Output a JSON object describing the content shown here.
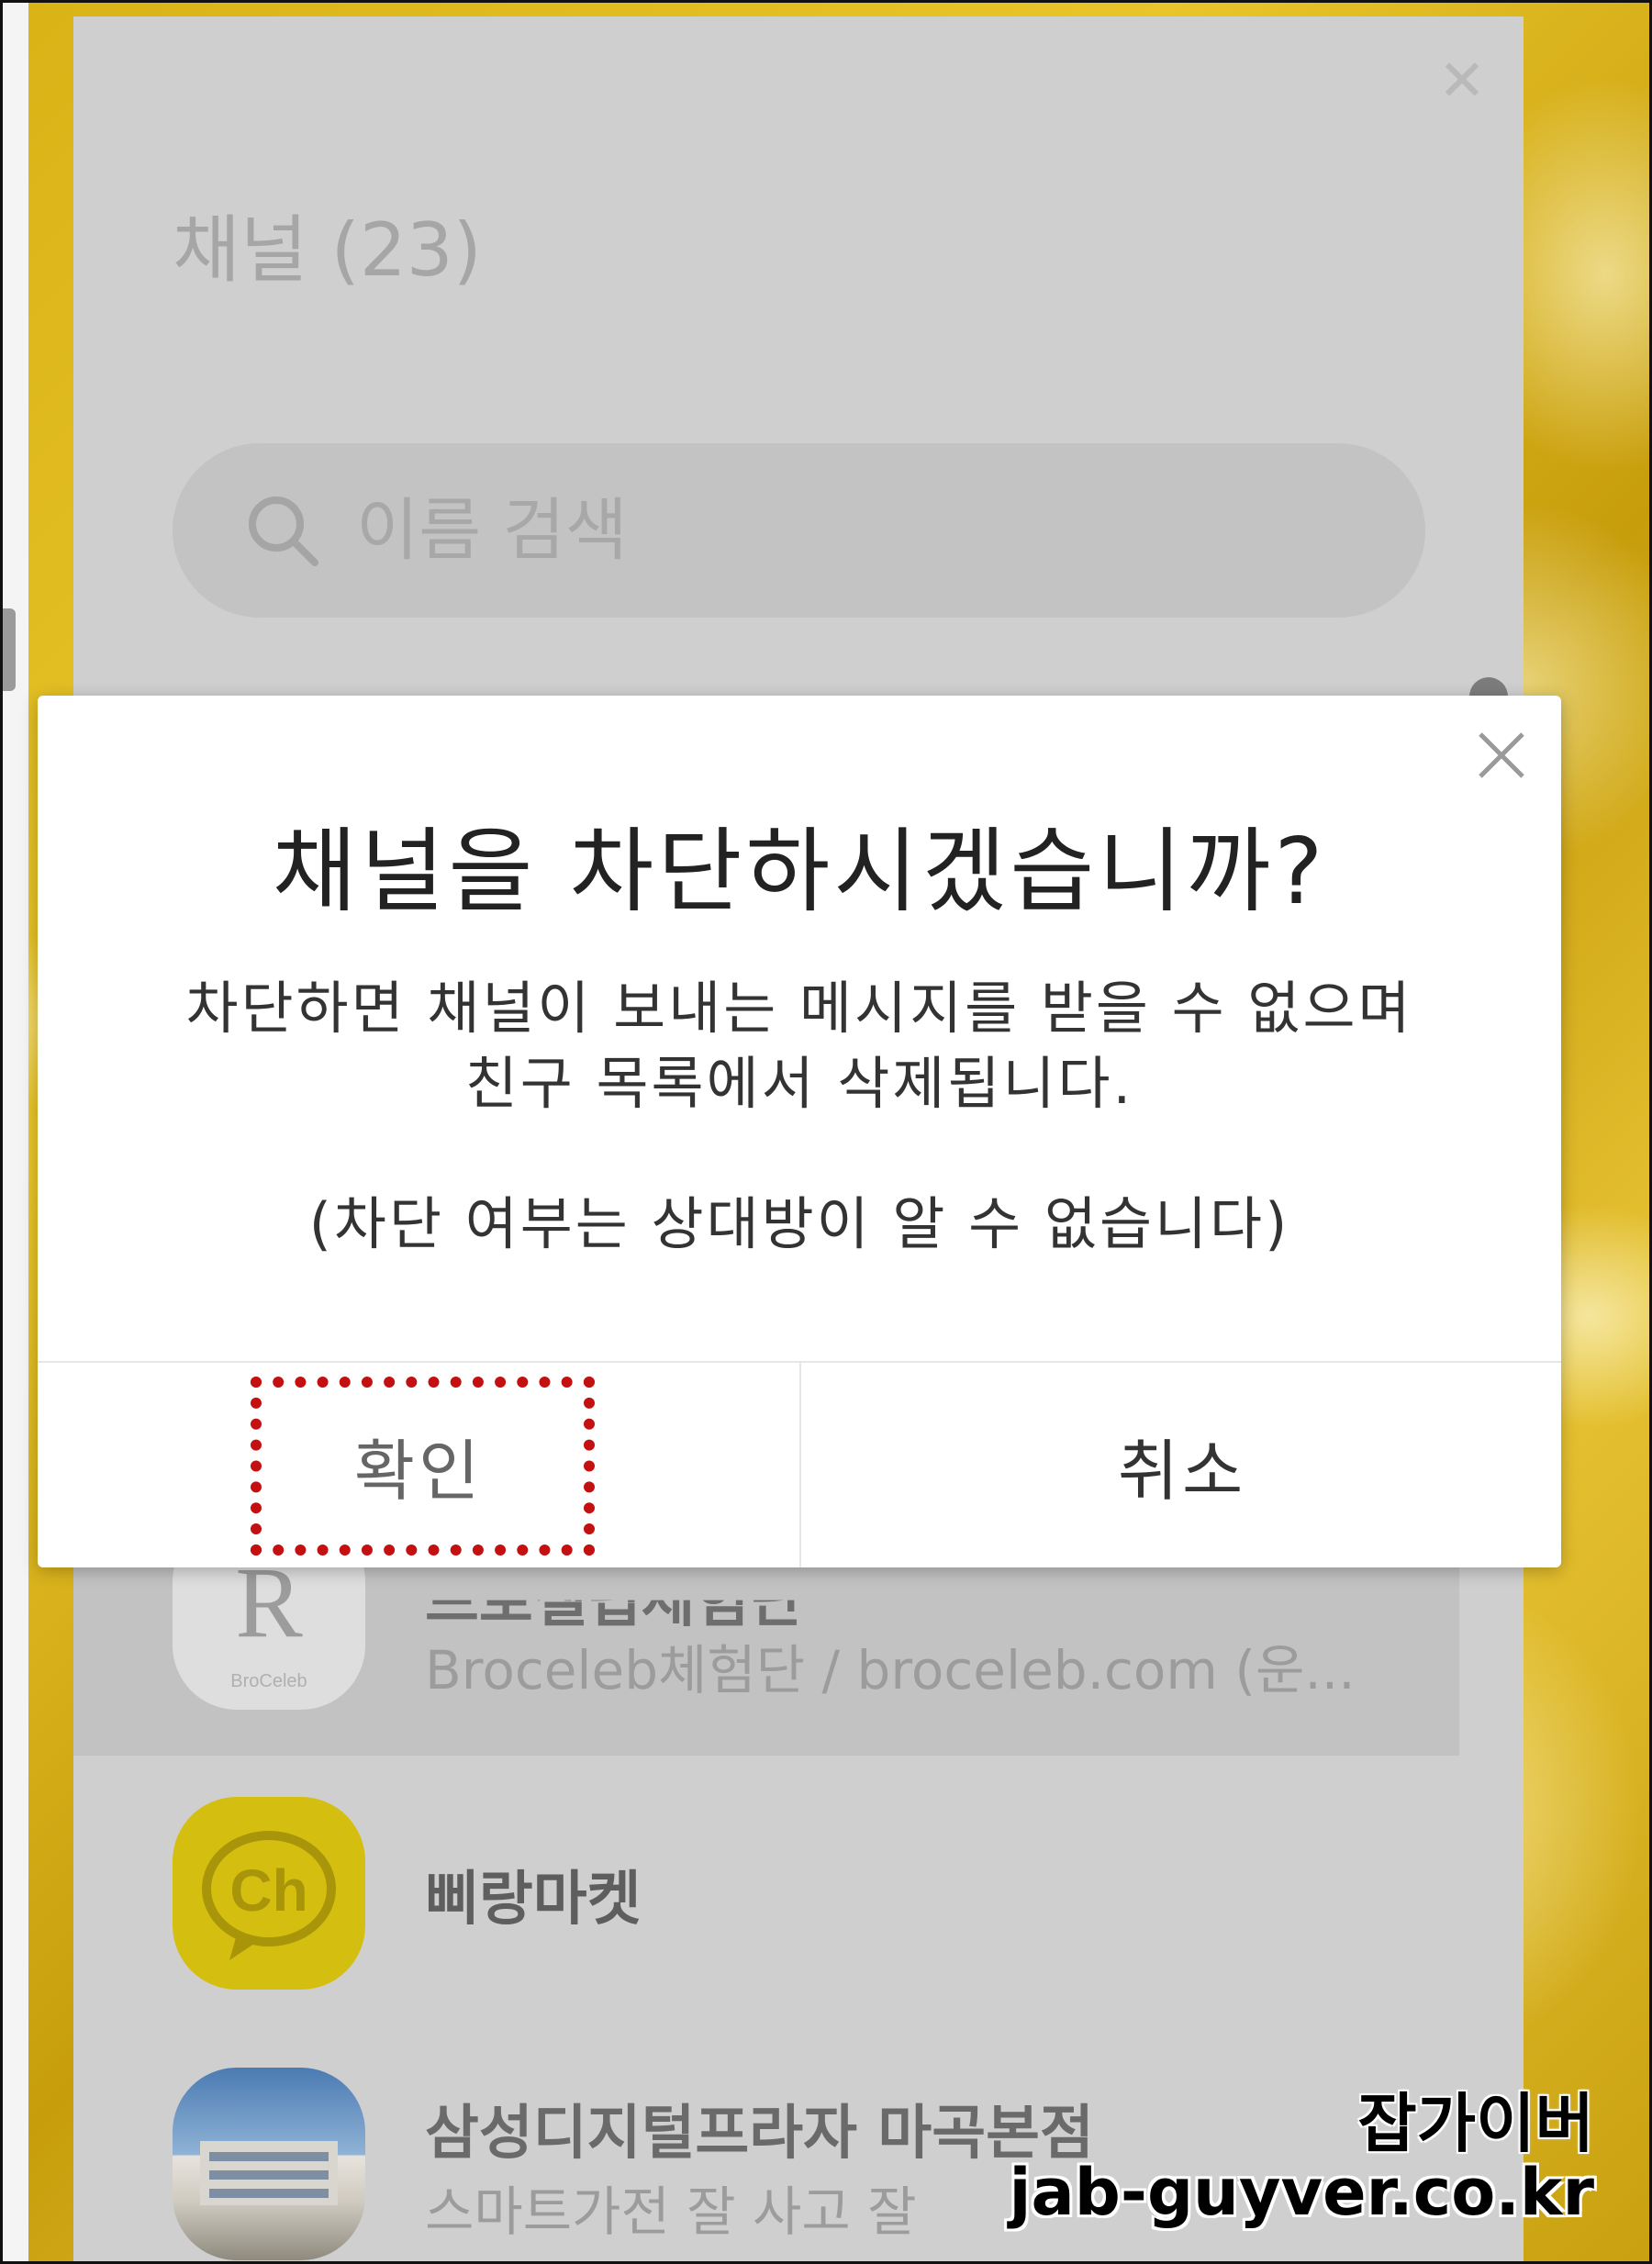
{
  "background_window": {
    "title": "채널 (23)",
    "search_placeholder": "이름 검색",
    "list": [
      {
        "name": "브로셀럽체험단",
        "subtitle": "Broceleb체험단 / broceleb.com (운...",
        "avatar_text": "BroCeleb"
      },
      {
        "name": "삐랑마켓",
        "subtitle": "",
        "avatar_text": "Ch"
      },
      {
        "name": "삼성디지털프라자 마곡본점",
        "subtitle": "스마트가전 잘 사고 잘",
        "avatar_text": ""
      }
    ]
  },
  "dialog": {
    "title": "채널을 차단하시겠습니까?",
    "body_line1": "차단하면 채널이 보내는 메시지를 받을 수 없으며",
    "body_line2": "친구 목록에서 삭제됩니다.",
    "note": "(차단 여부는 상대방이 알 수 없습니다)",
    "confirm_label": "확인",
    "cancel_label": "취소"
  },
  "watermark": {
    "name": "잡가이버",
    "url": "jab-guyver.co.kr"
  },
  "colors": {
    "dialog_bg": "#ffffff",
    "overlay_gray": "#cfcfcf",
    "highlight": "#c41010",
    "channel_yellow": "#d4be10"
  }
}
